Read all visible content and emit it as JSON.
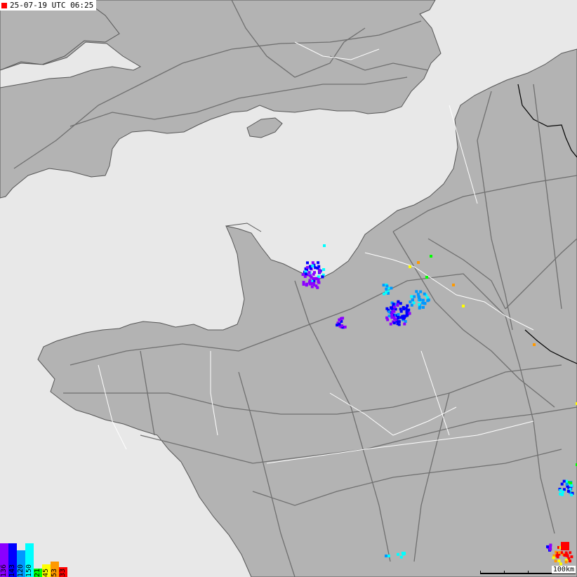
{
  "timestamp": "25-07-19 UTC 06:25",
  "colors": {
    "sea": "#e8e8e8",
    "land": "#b3b3b3",
    "coast": "#555555",
    "roads": "#6f6f6f",
    "rivers": "#ffffff",
    "borders": "#000000",
    "marker": "#ff0000"
  },
  "legend": [
    {
      "label": "136",
      "color": "#8b00ff"
    },
    {
      "label": "143",
      "color": "#0000ff"
    },
    {
      "label": "120",
      "color": "#0099ff"
    },
    {
      "label": "150",
      "color": "#00ffff"
    },
    {
      "label": "21",
      "color": "#00ff00"
    },
    {
      "label": "45",
      "color": "#ffff00"
    },
    {
      "label": "53",
      "color": "#ff9900"
    },
    {
      "label": "33",
      "color": "#ff0000"
    }
  ],
  "scale": {
    "label": "100km"
  }
}
